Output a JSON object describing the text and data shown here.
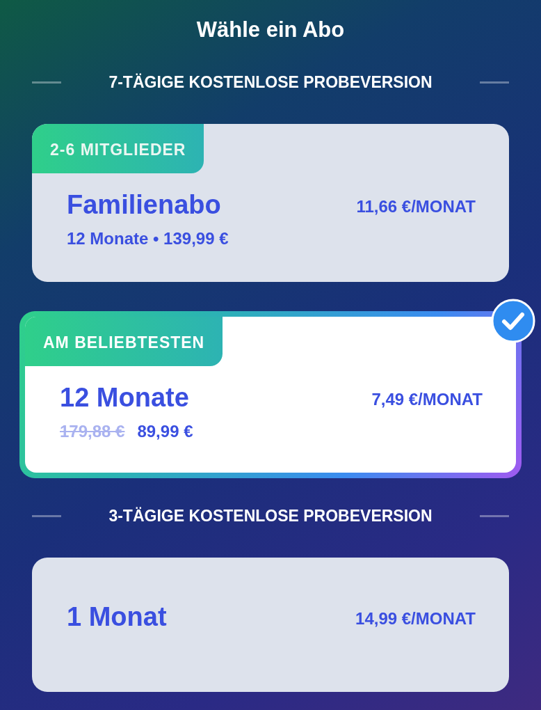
{
  "title": "Wähle ein Abo",
  "sections": [
    {
      "heading": "7-TÄGIGE KOSTENLOSE PROBEVERSION",
      "plans": [
        {
          "badge": "2-6 MITGLIEDER",
          "name": "Familienabo",
          "detail": "12 Monate • 139,99 €",
          "per_month": "11,66 €/MONAT",
          "selected": false
        },
        {
          "badge": "AM BELIEBTESTEN",
          "name": "12 Monate",
          "old_price": "179,88 €",
          "price": "89,99 €",
          "per_month": "7,49 €/MONAT",
          "selected": true
        }
      ]
    },
    {
      "heading": "3-TÄGIGE KOSTENLOSE PROBEVERSION",
      "plans": [
        {
          "name": "1 Monat",
          "per_month": "14,99 €/MONAT",
          "selected": false
        }
      ]
    }
  ]
}
